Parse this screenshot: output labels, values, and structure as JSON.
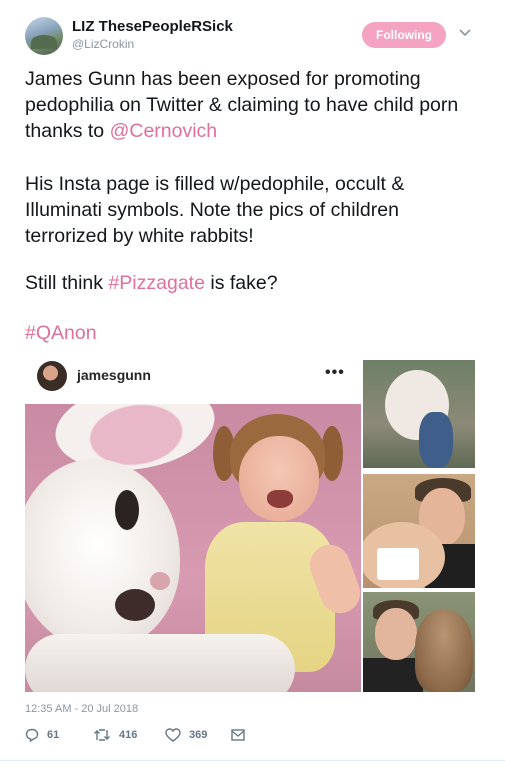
{
  "header": {
    "display_name": "LIZ ThesePeopleRSick",
    "handle": "@LizCrokin",
    "follow_label": "Following",
    "caret_icon": "chevron-down-icon"
  },
  "tweet": {
    "p1_text": "James Gunn has been exposed for promoting pedophilia on Twitter & claiming to have child porn thanks to ",
    "p1_mention": "@Cernovich",
    "p2_text": "His Insta page is filled w/pedophile, occult & Illuminati symbols. Note the pics of children terrorized by white rabbits!",
    "p3_pre": "Still think ",
    "p3_hashtag": "#Pizzagate",
    "p3_post": " is fake?",
    "p4_hashtag": "#QAnon"
  },
  "embed": {
    "ig_username": "jamesgunn",
    "ig_more": "•••"
  },
  "footer": {
    "timestamp": "12:35 AM - 20 Jul 2018",
    "replies": "61",
    "retweets": "416",
    "likes": "369"
  },
  "colors": {
    "accent_pink": "#e0709a",
    "follow_bg": "#f4a3c2",
    "meta_gray": "#8a96a3"
  }
}
